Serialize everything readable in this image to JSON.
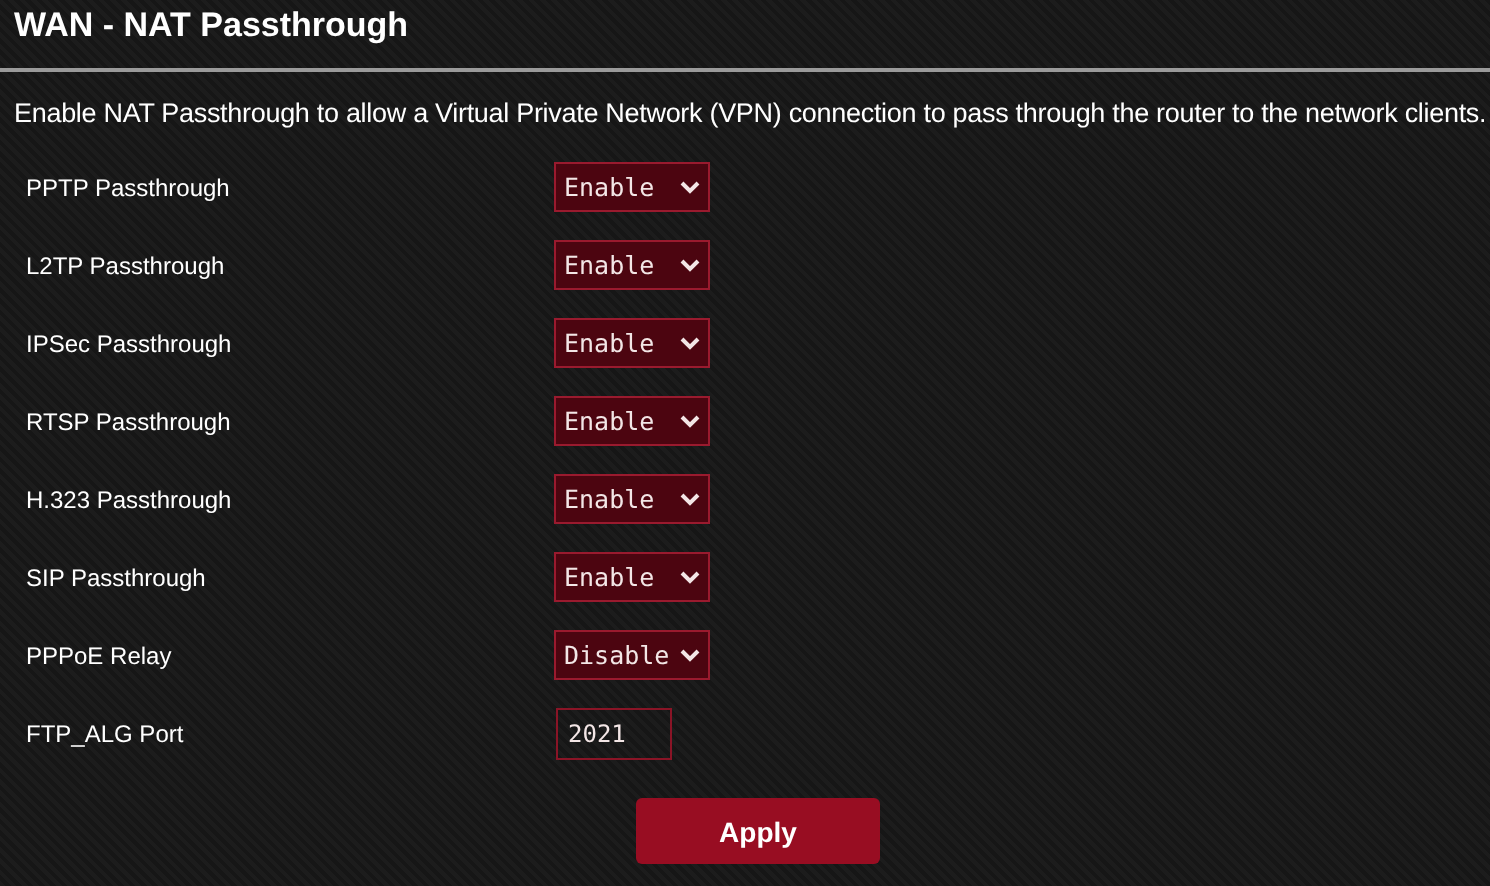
{
  "title": "WAN - NAT Passthrough",
  "description": "Enable NAT Passthrough to allow a Virtual Private Network (VPN) connection to pass through the router to the network clients.",
  "settings": [
    {
      "kind": "select",
      "label": "PPTP Passthrough",
      "value": "Enable"
    },
    {
      "kind": "select",
      "label": "L2TP Passthrough",
      "value": "Enable"
    },
    {
      "kind": "select",
      "label": "IPSec Passthrough",
      "value": "Enable"
    },
    {
      "kind": "select",
      "label": "RTSP Passthrough",
      "value": "Enable"
    },
    {
      "kind": "select",
      "label": "H.323 Passthrough",
      "value": "Enable"
    },
    {
      "kind": "select",
      "label": "SIP Passthrough",
      "value": "Enable"
    },
    {
      "kind": "select",
      "label": "PPPoE Relay",
      "value": "Disable"
    },
    {
      "kind": "input",
      "label": "FTP_ALG Port",
      "value": "2021"
    }
  ],
  "apply_button": "Apply"
}
